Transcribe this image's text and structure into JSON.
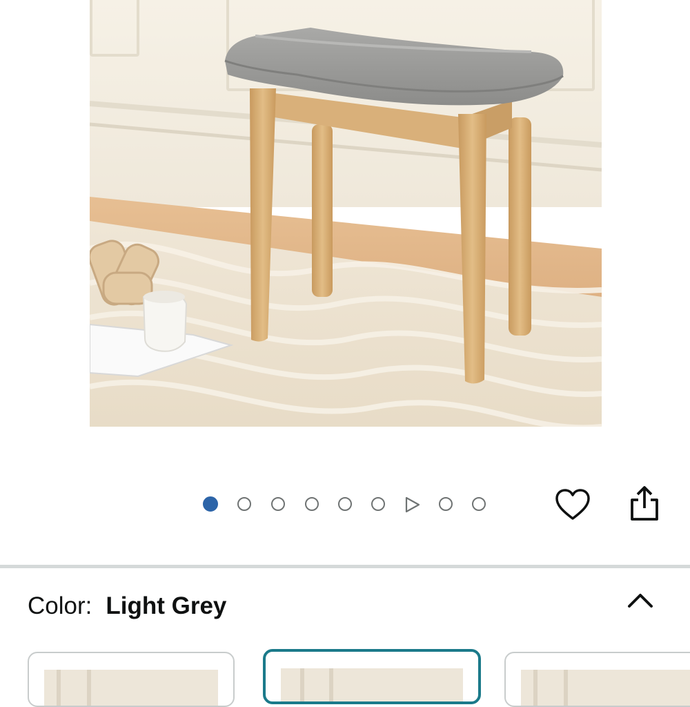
{
  "product": {
    "image_alt": "Upholstered vanity stool with curved grey fabric seat and natural wood legs"
  },
  "carousel": {
    "total_slides": 9,
    "active_index": 0,
    "video_slide_index": 6
  },
  "actions": {
    "wishlist_icon": "heart-icon",
    "share_icon": "share-icon"
  },
  "color": {
    "label": "Color:",
    "value": "Light Grey",
    "collapse_icon": "chevron-up-icon"
  },
  "swatches": [
    {
      "selected": false
    },
    {
      "selected": true
    },
    {
      "selected": false
    }
  ],
  "colors": {
    "active_dot": "#2c64a8",
    "selected_border": "#1b7a8a",
    "divider": "#d5d9d9"
  }
}
